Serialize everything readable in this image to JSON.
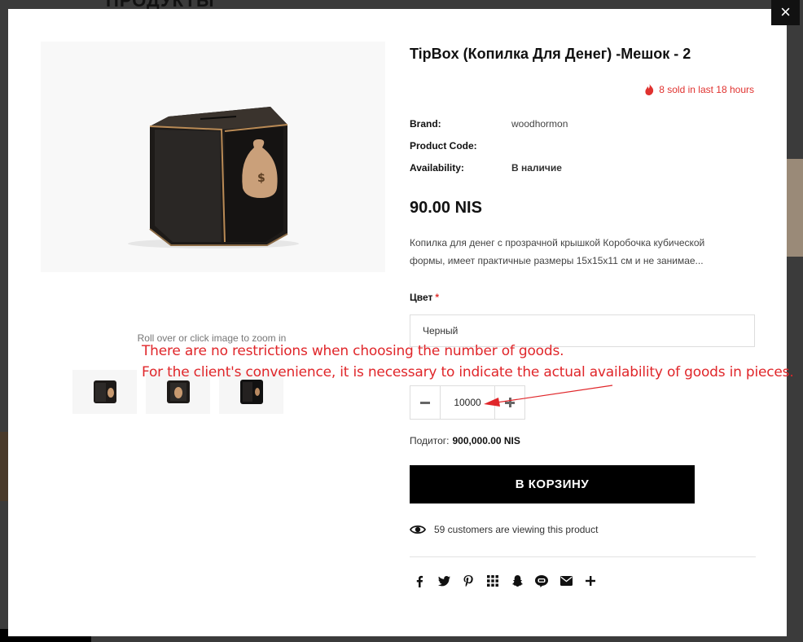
{
  "background": {
    "heading": "ПРОДУКТЫ"
  },
  "modal": {
    "close_label": "×",
    "zoom_hint": "Roll over or click image to zoom in",
    "product": {
      "title": "TipBox (Копилка Для Денег) -Мешок - 2",
      "sold_text": "8 sold in last 18 hours",
      "brand_label": "Brand:",
      "brand_value": "woodhormon",
      "code_label": "Product Code:",
      "code_value": "",
      "availability_label": "Availability:",
      "availability_value": "В наличие",
      "price": "90.00 NIS",
      "description": "Копилка для денег с прозрачной крышкой Коробочка кубической формы, имеет практичные размеры 15х15х11 см и не занимае...",
      "color_label": "Цвет",
      "required_mark": "*",
      "color_value": "Черный",
      "quantity": "10000",
      "subtotal_label": "Подитог:",
      "subtotal_value": "900,000.00 NIS",
      "cart_button": "В КОРЗИНУ",
      "viewing_text": "59 customers are viewing this product"
    },
    "share_icons": [
      "facebook-icon",
      "twitter-icon",
      "pinterest-icon",
      "grid-icon",
      "snapchat-icon",
      "line-icon",
      "email-icon",
      "more-icon"
    ]
  },
  "annotation": {
    "line1": "There are no restrictions when choosing the number of goods.",
    "line2": "For the client's convenience, it is necessary to indicate the actual availability of goods in pieces.",
    "color": "#e0262a"
  }
}
